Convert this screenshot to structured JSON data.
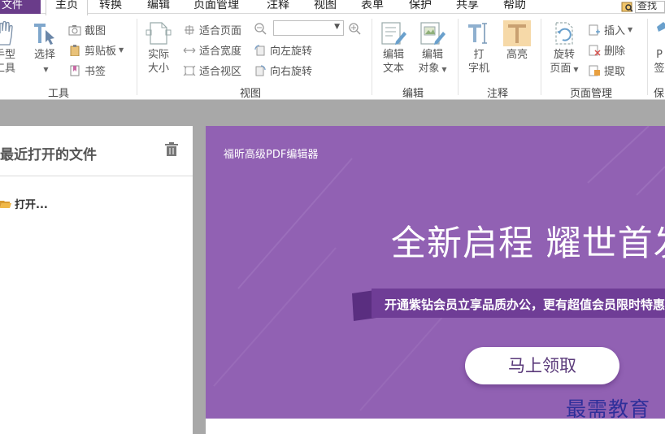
{
  "tabs": {
    "file": "文件",
    "items": [
      "主页",
      "转换",
      "编辑",
      "页面管理",
      "注释",
      "视图",
      "表单",
      "保护",
      "共享",
      "帮助"
    ],
    "active_index": 0
  },
  "search": {
    "label": "查找"
  },
  "ribbon": {
    "tools": {
      "label": "工具",
      "hand": "手型\n工具",
      "select": "选择"
    },
    "view": {
      "label": "视图",
      "actual_size": "实际\n大小",
      "screenshot": "截图",
      "clipboard": "剪贴板",
      "bookmark": "书签",
      "fit_page": "适合页面",
      "fit_width": "适合宽度",
      "fit_visible": "适合视区",
      "rotate_left": "向左旋转",
      "rotate_right": "向右旋转",
      "zoom_value": ""
    },
    "edit": {
      "label": "编辑",
      "edit_text": "编辑\n文本",
      "edit_object": "编辑\n对象"
    },
    "comment": {
      "label": "注释",
      "typewriter": "打\n字机",
      "highlight": "高亮"
    },
    "page_mgmt": {
      "label": "页面管理",
      "rotate_page": "旋转\n页面",
      "insert": "插入",
      "delete": "删除",
      "extract": "提取"
    },
    "protect": {
      "label": "保",
      "pdf_sign": "P\n签"
    }
  },
  "left_panel": {
    "title": "最近打开的文件",
    "open_label": "打开..."
  },
  "banner": {
    "brand": "福昕高级PDF编辑器",
    "headline": "全新启程 耀世首发",
    "tagline": "开通紫钻会员立享品质办公，更有超值会员限时特惠",
    "cta": "马上领取"
  },
  "watermark": "最需教育",
  "colors": {
    "file_tab": "#6a3c8a",
    "banner": "#9161b3",
    "ribbon_tag": "#6f3d96",
    "accent_orange": "#e8a040"
  }
}
